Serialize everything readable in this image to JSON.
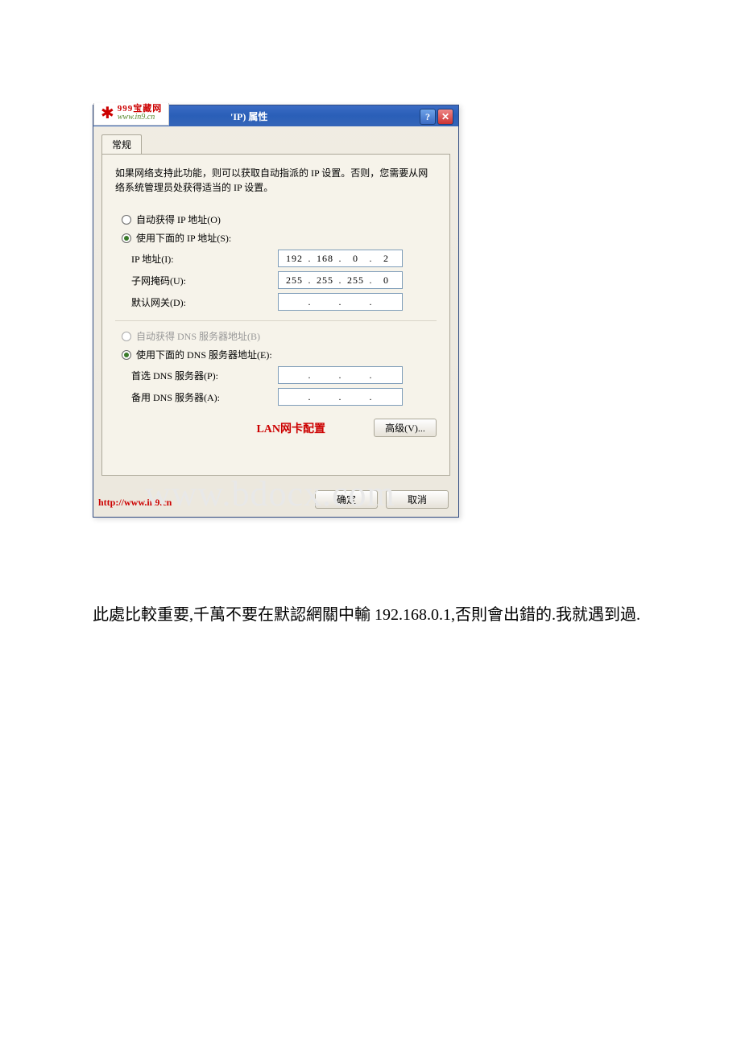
{
  "watermark_logo": {
    "top": "999宝藏网",
    "bottom": "www.in9.cn"
  },
  "titlebar": {
    "title_fragment": "'IP) 属性"
  },
  "tab": {
    "label": "常规"
  },
  "description": "如果网络支持此功能，则可以获取自动指派的 IP 设置。否则，您需要从网络系统管理员处获得适当的 IP 设置。",
  "ip_section": {
    "auto_label": "自动获得 IP 地址(O)",
    "manual_label": "使用下面的 IP 地址(S):",
    "fields": {
      "ip_label": "IP 地址(I):",
      "ip_value": {
        "o1": "192",
        "o2": "168",
        "o3": "0",
        "o4": "2"
      },
      "mask_label": "子网掩码(U):",
      "mask_value": {
        "o1": "255",
        "o2": "255",
        "o3": "255",
        "o4": "0"
      },
      "gateway_label": "默认网关(D):",
      "gateway_value": {
        "o1": "",
        "o2": "",
        "o3": "",
        "o4": ""
      }
    }
  },
  "dns_section": {
    "auto_label": "自动获得 DNS 服务器地址(B)",
    "manual_label": "使用下面的 DNS 服务器地址(E):",
    "fields": {
      "primary_label": "首选 DNS 服务器(P):",
      "primary_value": {
        "o1": "",
        "o2": "",
        "o3": "",
        "o4": ""
      },
      "alt_label": "备用 DNS 服务器(A):",
      "alt_value": {
        "o1": "",
        "o2": "",
        "o3": "",
        "o4": ""
      }
    }
  },
  "advanced_button": "高级(V)...",
  "caption": "LAN网卡配置",
  "footer": {
    "link": "http://www.in9.cn",
    "ok": "确定",
    "cancel": "取消"
  },
  "big_watermark": "www.bdocx.com",
  "note_text": "此處比較重要,千萬不要在默認網關中輸 192.168.0.1,否則會出錯的.我就遇到過."
}
